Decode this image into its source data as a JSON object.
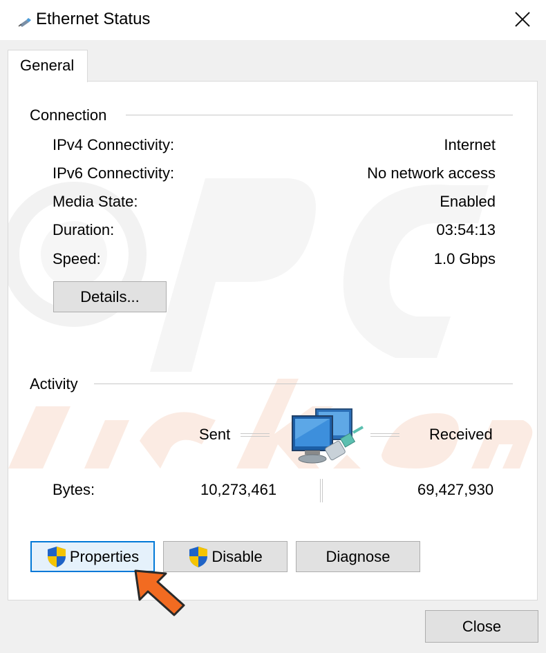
{
  "window": {
    "title": "Ethernet Status",
    "icon": "ethernet-icon",
    "close_icon": "close-icon"
  },
  "tabs": [
    {
      "label": "General",
      "selected": true
    }
  ],
  "connection": {
    "title": "Connection",
    "rows": [
      {
        "label": "IPv4 Connectivity:",
        "value": "Internet"
      },
      {
        "label": "IPv6 Connectivity:",
        "value": "No network access"
      },
      {
        "label": "Media State:",
        "value": "Enabled"
      },
      {
        "label": "Duration:",
        "value": "03:54:13"
      },
      {
        "label": "Speed:",
        "value": "1.0 Gbps"
      }
    ],
    "details_button": "Details..."
  },
  "activity": {
    "title": "Activity",
    "sent_label": "Sent",
    "received_label": "Received",
    "bytes_label": "Bytes:",
    "bytes_sent": "10,273,461",
    "bytes_received": "69,427,930",
    "icon": "network-computers-icon"
  },
  "buttons": {
    "properties": "Properties",
    "disable": "Disable",
    "diagnose": "Diagnose",
    "close": "Close"
  },
  "colors": {
    "accent": "#0078d7",
    "arrow": "#f26b21",
    "button_face": "#e1e1e1"
  }
}
